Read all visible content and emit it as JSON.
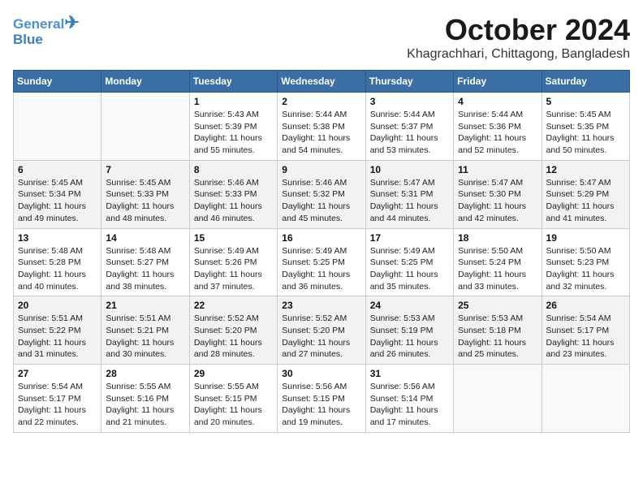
{
  "logo": {
    "line1": "General",
    "line2": "Blue"
  },
  "title": "October 2024",
  "location": "Khagrachhari, Chittagong, Bangladesh",
  "weekdays": [
    "Sunday",
    "Monday",
    "Tuesday",
    "Wednesday",
    "Thursday",
    "Friday",
    "Saturday"
  ],
  "weeks": [
    [
      {
        "day": "",
        "sunrise": "",
        "sunset": "",
        "daylight": ""
      },
      {
        "day": "",
        "sunrise": "",
        "sunset": "",
        "daylight": ""
      },
      {
        "day": "1",
        "sunrise": "Sunrise: 5:43 AM",
        "sunset": "Sunset: 5:39 PM",
        "daylight": "Daylight: 11 hours and 55 minutes."
      },
      {
        "day": "2",
        "sunrise": "Sunrise: 5:44 AM",
        "sunset": "Sunset: 5:38 PM",
        "daylight": "Daylight: 11 hours and 54 minutes."
      },
      {
        "day": "3",
        "sunrise": "Sunrise: 5:44 AM",
        "sunset": "Sunset: 5:37 PM",
        "daylight": "Daylight: 11 hours and 53 minutes."
      },
      {
        "day": "4",
        "sunrise": "Sunrise: 5:44 AM",
        "sunset": "Sunset: 5:36 PM",
        "daylight": "Daylight: 11 hours and 52 minutes."
      },
      {
        "day": "5",
        "sunrise": "Sunrise: 5:45 AM",
        "sunset": "Sunset: 5:35 PM",
        "daylight": "Daylight: 11 hours and 50 minutes."
      }
    ],
    [
      {
        "day": "6",
        "sunrise": "Sunrise: 5:45 AM",
        "sunset": "Sunset: 5:34 PM",
        "daylight": "Daylight: 11 hours and 49 minutes."
      },
      {
        "day": "7",
        "sunrise": "Sunrise: 5:45 AM",
        "sunset": "Sunset: 5:33 PM",
        "daylight": "Daylight: 11 hours and 48 minutes."
      },
      {
        "day": "8",
        "sunrise": "Sunrise: 5:46 AM",
        "sunset": "Sunset: 5:33 PM",
        "daylight": "Daylight: 11 hours and 46 minutes."
      },
      {
        "day": "9",
        "sunrise": "Sunrise: 5:46 AM",
        "sunset": "Sunset: 5:32 PM",
        "daylight": "Daylight: 11 hours and 45 minutes."
      },
      {
        "day": "10",
        "sunrise": "Sunrise: 5:47 AM",
        "sunset": "Sunset: 5:31 PM",
        "daylight": "Daylight: 11 hours and 44 minutes."
      },
      {
        "day": "11",
        "sunrise": "Sunrise: 5:47 AM",
        "sunset": "Sunset: 5:30 PM",
        "daylight": "Daylight: 11 hours and 42 minutes."
      },
      {
        "day": "12",
        "sunrise": "Sunrise: 5:47 AM",
        "sunset": "Sunset: 5:29 PM",
        "daylight": "Daylight: 11 hours and 41 minutes."
      }
    ],
    [
      {
        "day": "13",
        "sunrise": "Sunrise: 5:48 AM",
        "sunset": "Sunset: 5:28 PM",
        "daylight": "Daylight: 11 hours and 40 minutes."
      },
      {
        "day": "14",
        "sunrise": "Sunrise: 5:48 AM",
        "sunset": "Sunset: 5:27 PM",
        "daylight": "Daylight: 11 hours and 38 minutes."
      },
      {
        "day": "15",
        "sunrise": "Sunrise: 5:49 AM",
        "sunset": "Sunset: 5:26 PM",
        "daylight": "Daylight: 11 hours and 37 minutes."
      },
      {
        "day": "16",
        "sunrise": "Sunrise: 5:49 AM",
        "sunset": "Sunset: 5:25 PM",
        "daylight": "Daylight: 11 hours and 36 minutes."
      },
      {
        "day": "17",
        "sunrise": "Sunrise: 5:49 AM",
        "sunset": "Sunset: 5:25 PM",
        "daylight": "Daylight: 11 hours and 35 minutes."
      },
      {
        "day": "18",
        "sunrise": "Sunrise: 5:50 AM",
        "sunset": "Sunset: 5:24 PM",
        "daylight": "Daylight: 11 hours and 33 minutes."
      },
      {
        "day": "19",
        "sunrise": "Sunrise: 5:50 AM",
        "sunset": "Sunset: 5:23 PM",
        "daylight": "Daylight: 11 hours and 32 minutes."
      }
    ],
    [
      {
        "day": "20",
        "sunrise": "Sunrise: 5:51 AM",
        "sunset": "Sunset: 5:22 PM",
        "daylight": "Daylight: 11 hours and 31 minutes."
      },
      {
        "day": "21",
        "sunrise": "Sunrise: 5:51 AM",
        "sunset": "Sunset: 5:21 PM",
        "daylight": "Daylight: 11 hours and 30 minutes."
      },
      {
        "day": "22",
        "sunrise": "Sunrise: 5:52 AM",
        "sunset": "Sunset: 5:20 PM",
        "daylight": "Daylight: 11 hours and 28 minutes."
      },
      {
        "day": "23",
        "sunrise": "Sunrise: 5:52 AM",
        "sunset": "Sunset: 5:20 PM",
        "daylight": "Daylight: 11 hours and 27 minutes."
      },
      {
        "day": "24",
        "sunrise": "Sunrise: 5:53 AM",
        "sunset": "Sunset: 5:19 PM",
        "daylight": "Daylight: 11 hours and 26 minutes."
      },
      {
        "day": "25",
        "sunrise": "Sunrise: 5:53 AM",
        "sunset": "Sunset: 5:18 PM",
        "daylight": "Daylight: 11 hours and 25 minutes."
      },
      {
        "day": "26",
        "sunrise": "Sunrise: 5:54 AM",
        "sunset": "Sunset: 5:17 PM",
        "daylight": "Daylight: 11 hours and 23 minutes."
      }
    ],
    [
      {
        "day": "27",
        "sunrise": "Sunrise: 5:54 AM",
        "sunset": "Sunset: 5:17 PM",
        "daylight": "Daylight: 11 hours and 22 minutes."
      },
      {
        "day": "28",
        "sunrise": "Sunrise: 5:55 AM",
        "sunset": "Sunset: 5:16 PM",
        "daylight": "Daylight: 11 hours and 21 minutes."
      },
      {
        "day": "29",
        "sunrise": "Sunrise: 5:55 AM",
        "sunset": "Sunset: 5:15 PM",
        "daylight": "Daylight: 11 hours and 20 minutes."
      },
      {
        "day": "30",
        "sunrise": "Sunrise: 5:56 AM",
        "sunset": "Sunset: 5:15 PM",
        "daylight": "Daylight: 11 hours and 19 minutes."
      },
      {
        "day": "31",
        "sunrise": "Sunrise: 5:56 AM",
        "sunset": "Sunset: 5:14 PM",
        "daylight": "Daylight: 11 hours and 17 minutes."
      },
      {
        "day": "",
        "sunrise": "",
        "sunset": "",
        "daylight": ""
      },
      {
        "day": "",
        "sunrise": "",
        "sunset": "",
        "daylight": ""
      }
    ]
  ]
}
